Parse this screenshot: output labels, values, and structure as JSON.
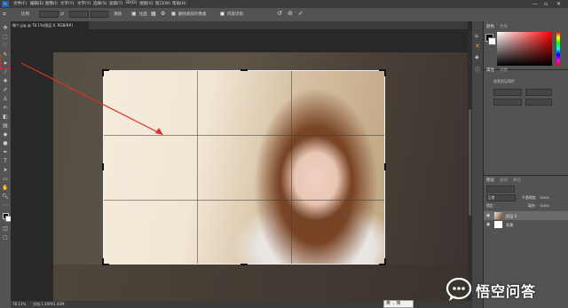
{
  "menubar": {
    "items": [
      "文件(F)",
      "编辑(E)",
      "图像(I)",
      "文字(Y)",
      "选择(S)",
      "滤镜(T)",
      "3D(D)",
      "视图(V)",
      "窗口(W)",
      "帮助(H)"
    ],
    "window_controls": [
      "—",
      "▫",
      "✕"
    ]
  },
  "options_bar": {
    "ratio_label": "比例",
    "clear_label": "清除",
    "straighten_label": "拉直",
    "delete_cropped_label": "删除裁剪的像素",
    "content_aware_label": "内容识别"
  },
  "document_tab": {
    "title": "微个.jpg @ 78.1%(图层 0, RGB/8#)"
  },
  "status_bar": {
    "zoom": "78.13%",
    "doc_info": "文档:1.40M/1.40M"
  },
  "panels": {
    "color_tab": "颜色",
    "swatches_tab": "色板",
    "properties_tab": "属性",
    "adjustments_tab": "调整",
    "properties_subtitle": "像素图层属性",
    "layers_tab": "图层",
    "channels_tab": "通道",
    "paths_tab": "路径",
    "blend_mode": "正常",
    "opacity_label": "不透明度:",
    "opacity_value": "100%",
    "lock_label": "锁定:",
    "fill_label": "填充:",
    "fill_value": "100%",
    "layers": [
      {
        "name": "图层 0"
      },
      {
        "name": "背景"
      }
    ]
  },
  "ime": {
    "text": "英 ·, 简"
  },
  "watermark": {
    "text": "悟空问答"
  },
  "colors": {
    "annotation_red": "#e0302a"
  }
}
